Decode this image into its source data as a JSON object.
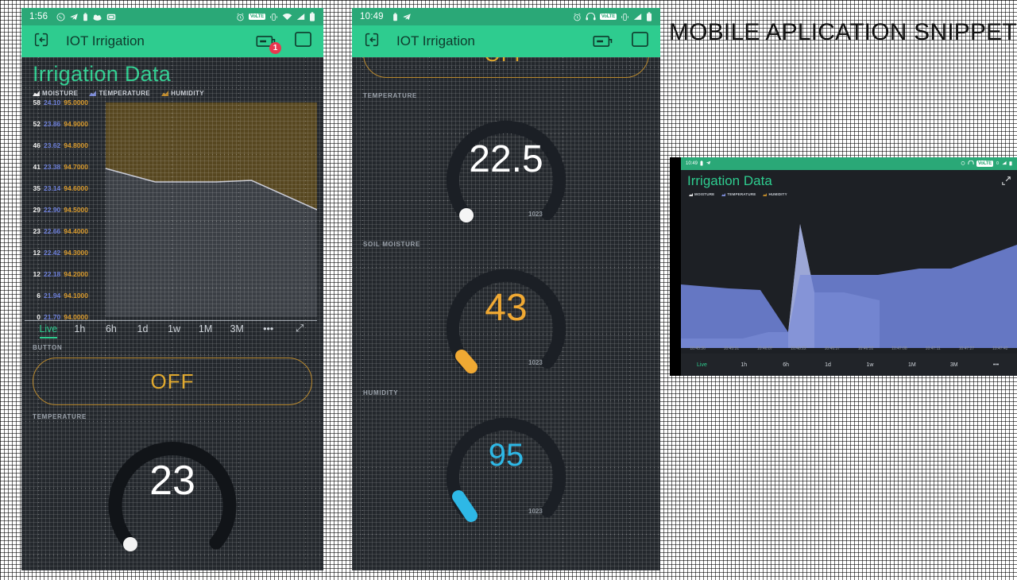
{
  "heading": "MOBILE APLICATION SNIPPETS",
  "phone1": {
    "statusbar": {
      "time": "1:56",
      "left_icons": [
        "whatsapp-icon",
        "telegram-icon",
        "battery-saver-icon",
        "cloud-sync-icon",
        "screenshot-icon"
      ],
      "right_icons": [
        "alarm-icon",
        "volte-icon",
        "vibrate-icon",
        "wifi-icon",
        "signal-icon",
        "battery-icon"
      ],
      "volte_label": "VoLTE"
    },
    "appbar": {
      "title": "IOT Irrigation",
      "back_icon": "exit-app-icon",
      "device_icon": "device-icon",
      "badge": "1",
      "window_icon": "window-icon"
    },
    "card_title": "Irrigation Data",
    "legend": [
      {
        "label": "MOISTURE",
        "color": "#e8e8ea"
      },
      {
        "label": "TEMPERATURE",
        "color": "#7b8ad6"
      },
      {
        "label": "HUMIDITY",
        "color": "#c08a2a"
      }
    ],
    "time_ranges": [
      {
        "label": "Live",
        "active": true
      },
      {
        "label": "1h",
        "active": false
      },
      {
        "label": "6h",
        "active": false
      },
      {
        "label": "1d",
        "active": false
      },
      {
        "label": "1w",
        "active": false
      },
      {
        "label": "1M",
        "active": false
      },
      {
        "label": "3M",
        "active": false
      },
      {
        "label": "•••",
        "active": false
      },
      {
        "label": "⤢",
        "active": false
      }
    ],
    "button_section_label": "BUTTON",
    "button_state": "OFF",
    "temperature_section_label": "TEMPERATURE",
    "temperature_value": "23"
  },
  "phone2": {
    "statusbar": {
      "time": "10:49",
      "left_icons": [
        "battery-saver-icon",
        "telegram-icon"
      ],
      "right_icons": [
        "alarm-icon",
        "headset-icon",
        "volte-icon",
        "vibrate-icon",
        "signal-icon",
        "battery-icon"
      ],
      "volte_label": "VoLTE"
    },
    "appbar": {
      "title": "IOT Irrigation",
      "back_icon": "exit-app-icon",
      "device_icon": "device-icon",
      "window_icon": "window-icon"
    },
    "button_state": "OFF",
    "gauges": [
      {
        "section": "TEMPERATURE",
        "value": "22.5",
        "min": "0",
        "max": "1023",
        "color": "#ffffff",
        "pct": 0.035
      },
      {
        "section": "SOIL MOISTURE",
        "value": "43",
        "min": "0",
        "max": "1023",
        "color": "#f0a933",
        "pct": 0.06
      },
      {
        "section": "HUMIDITY",
        "value": "95",
        "min": "0",
        "max": "1023",
        "color": "#2eb8e6",
        "pct": 0.1
      }
    ]
  },
  "mini": {
    "statusbar": {
      "time": "10:49"
    },
    "card_title": "Irrigation Data",
    "legend": [
      {
        "label": "MOISTURE",
        "color": "#e8e8ea"
      },
      {
        "label": "TEMPERATURE",
        "color": "#7b8ad6"
      },
      {
        "label": "HUMIDITY",
        "color": "#c08a2a"
      }
    ],
    "expand_icon": "fullscreen-icon",
    "time_ranges": [
      {
        "label": "Live",
        "active": true
      },
      {
        "label": "1h",
        "active": false
      },
      {
        "label": "6h",
        "active": false
      },
      {
        "label": "1d",
        "active": false
      },
      {
        "label": "1w",
        "active": false
      },
      {
        "label": "1M",
        "active": false
      },
      {
        "label": "3M",
        "active": false
      },
      {
        "label": "•••",
        "active": false
      }
    ],
    "x_ticks": [
      "10:45:36",
      "10:45:51",
      "10:46:07",
      "10:46:22",
      "10:46:37",
      "10:46:52",
      "10:47:08",
      "10:47:11",
      "10:47:27",
      "10:47:42"
    ]
  },
  "chart_data": {
    "type": "area",
    "title": "Irrigation Data",
    "grid": true,
    "legend_position": "top-left",
    "y_axes": [
      {
        "name": "MOISTURE",
        "color": "#e8e8ea",
        "ticks": [
          "58",
          "52",
          "46",
          "41",
          "35",
          "29",
          "23",
          "12",
          "12",
          "6",
          "0"
        ]
      },
      {
        "name": "TEMPERATURE",
        "color": "#7b8ad6",
        "ticks": [
          "24.10",
          "23.86",
          "23.62",
          "23.38",
          "23.14",
          "22.90",
          "22.66",
          "22.42",
          "22.18",
          "21.94",
          "21.70"
        ]
      },
      {
        "name": "HUMIDITY",
        "color": "#c08a2a",
        "ticks": [
          "95.0000",
          "94.9000",
          "94.8000",
          "94.7000",
          "94.6000",
          "94.5000",
          "94.4000",
          "94.3000",
          "94.2000",
          "94.1000",
          "94.0000"
        ]
      }
    ],
    "series": [
      {
        "name": "HUMIDITY",
        "color": "#6b5420",
        "fill": true,
        "values": [
          100,
          100,
          100,
          100,
          100,
          100
        ]
      },
      {
        "name": "MOISTURE",
        "color": "#c7c9d4",
        "fill": true,
        "values": [
          70,
          63,
          62,
          62,
          55,
          48
        ]
      },
      {
        "name": "TEMPERATURE",
        "color": "#7b8ad6",
        "fill": false,
        "values": []
      }
    ]
  },
  "mini_chart_data": {
    "type": "area",
    "title": "Irrigation Data",
    "series": [
      {
        "name": "MOISTURE",
        "color": "#dcdcd6",
        "values": [
          10,
          10,
          12,
          78,
          20,
          22,
          24,
          26
        ]
      },
      {
        "name": "TEMPERATURE",
        "color": "#6b7fd0",
        "values": [
          46,
          47,
          30,
          58,
          58,
          58,
          62,
          70
        ]
      }
    ]
  }
}
